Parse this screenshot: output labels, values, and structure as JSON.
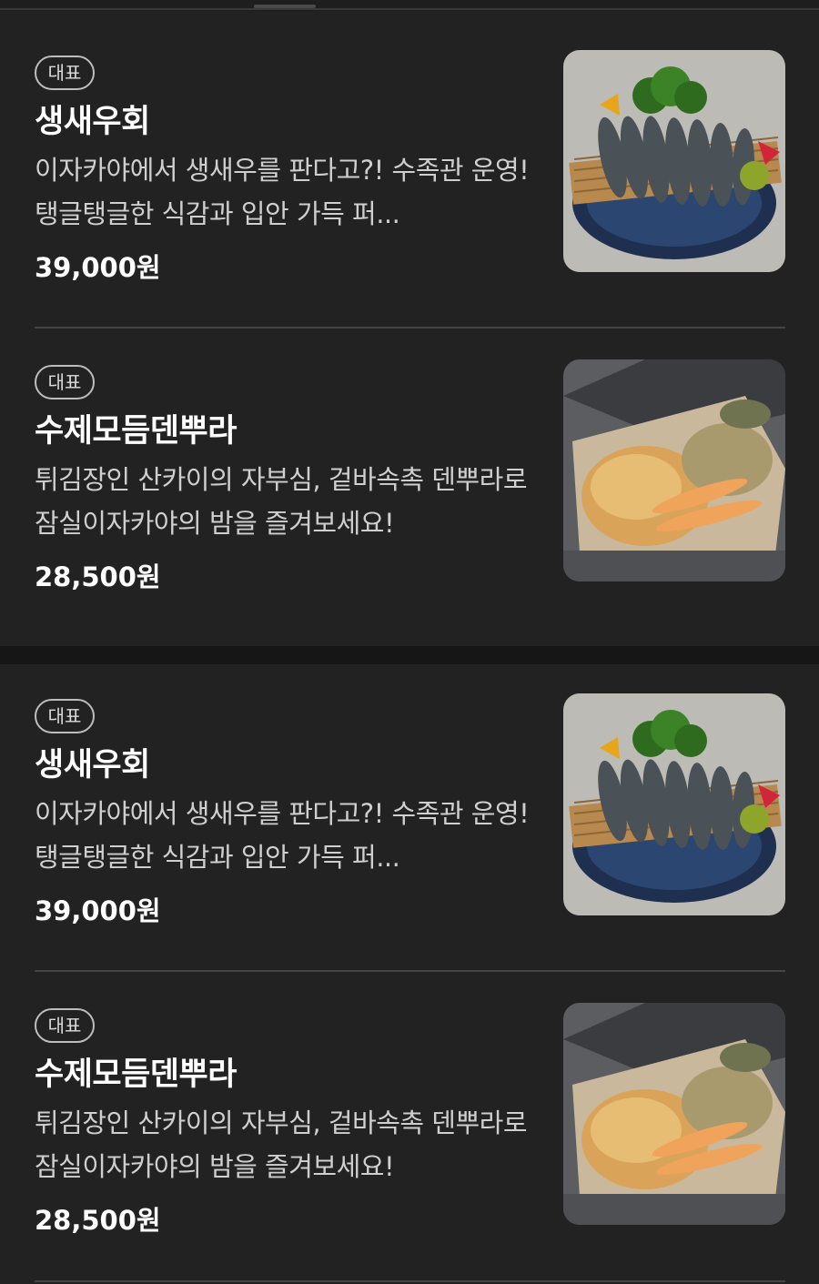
{
  "menu": {
    "sections": [
      {
        "items": [
          {
            "badge": "대표",
            "name": "생새우회",
            "description": "이자카야에서 생새우를 판다고?! 수족관 운영! 탱글탱글한 식감과 입안 가득 퍼...",
            "price": "39,000원",
            "image": "shrimp-sashimi-photo"
          },
          {
            "badge": "대표",
            "name": "수제모듬덴뿌라",
            "description": "튀김장인 산카이의 자부심, 겉바속촉 덴뿌라로 잠실이자카야의 밤을 즐겨보세요!",
            "price": "28,500원",
            "image": "tempura-photo"
          }
        ]
      },
      {
        "items": [
          {
            "badge": "대표",
            "name": "생새우회",
            "description": "이자카야에서 생새우를 판다고?! 수족관 운영! 탱글탱글한 식감과 입안 가득 퍼...",
            "price": "39,000원",
            "image": "shrimp-sashimi-photo"
          },
          {
            "badge": "대표",
            "name": "수제모듬덴뿌라",
            "description": "튀김장인 산카이의 자부심, 겉바속촉 덴뿌라로 잠실이자카야의 밤을 즐겨보세요!",
            "price": "28,500원",
            "image": "tempura-photo"
          }
        ]
      }
    ]
  }
}
